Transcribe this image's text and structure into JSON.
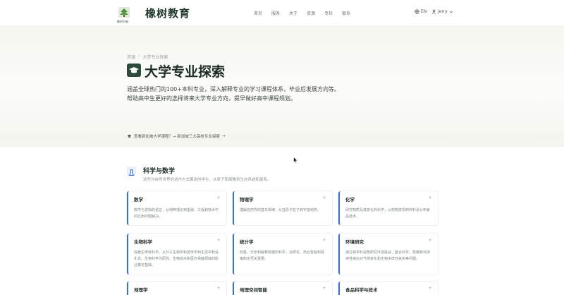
{
  "nav": {
    "logo_sub": "橡树书苑",
    "brand": "橡树教育",
    "menu": [
      "首页",
      "服务",
      "关于",
      "资源",
      "专栏",
      "联系"
    ],
    "lang": "EN",
    "user": "Jerry"
  },
  "hero": {
    "breadcrumb": [
      "资源",
      "›",
      "大学专业探索"
    ],
    "title": "大学专业探索",
    "desc_line1": "涵盖全球热门的100+本科专业，深入解释专业的学习课程体系，毕业后发展方向等。",
    "desc_line2": "帮助高中生更好的选择将来大学专业方向，提早做好高中课程规划。",
    "link_text": "查看新加坡大学课程？→ 新加坡三大高校专业探索"
  },
  "section": {
    "title": "科学与数学",
    "subtitle": "这些对自然世界的运作方式着迷的学生，从原子和细胞到生态系统和星系。"
  },
  "cards": [
    {
      "title": "数学",
      "desc": "数学与逻辑的语言，从纯粹理论到金融、工程和技术中的应用问题解决。"
    },
    {
      "title": "物理学",
      "desc": "理解自然界的基本规律，从亚原子粒子到宇宙结构。"
    },
    {
      "title": "化学",
      "desc": "研究物质及其变化的科学，从药物发现到材料设计到食品技术。"
    },
    {
      "title": "生物科学",
      "desc": "探索生命体科学，从分子生物学和遗传学到生态学和进化论。生物科学为研究、生物技术和医疗保健领域的职业奠定基础。"
    },
    {
      "title": "统计学",
      "desc": "收集、分析和解释数据的科学，对研究、商业智能和政策制定至关重要。"
    },
    {
      "title": "环境研究",
      "desc": "通过跨学科视角研究环境挑战，整合科学、政策和可持续性来应对气候变化和生物多样性丧失等问题。"
    },
    {
      "title": "地理学",
      "desc": ""
    },
    {
      "title": "地理空间智能",
      "desc": ""
    },
    {
      "title": "食品科学与技术",
      "desc": ""
    }
  ],
  "colors": {
    "accent": "#3b6fd0",
    "brand": "#2d4a3a"
  }
}
